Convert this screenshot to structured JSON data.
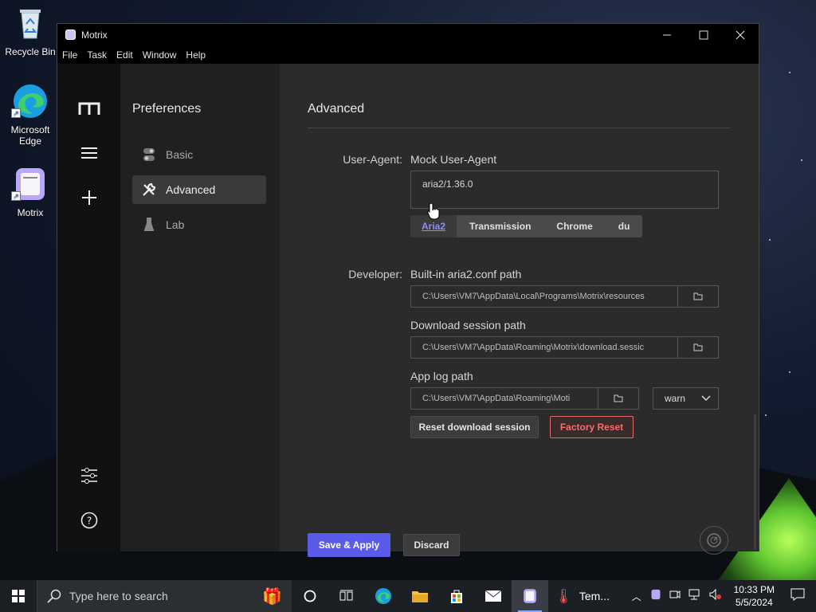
{
  "desktop": {
    "icons": [
      {
        "label": "Recycle Bin"
      },
      {
        "label": "Microsoft Edge"
      },
      {
        "label": "Motrix"
      }
    ]
  },
  "window": {
    "title": "Motrix",
    "menu": [
      "File",
      "Task",
      "Edit",
      "Window",
      "Help"
    ]
  },
  "sidebar": {
    "heading": "Preferences",
    "items": [
      {
        "label": "Basic",
        "icon": "toggle-icon"
      },
      {
        "label": "Advanced",
        "icon": "tools-icon",
        "active": true
      },
      {
        "label": "Lab",
        "icon": "flask-icon"
      }
    ]
  },
  "main": {
    "title": "Advanced",
    "user_agent": {
      "label": "User-Agent:",
      "sublabel": "Mock User-Agent",
      "value": "aria2/1.36.0",
      "presets": [
        "Aria2",
        "Transmission",
        "Chrome",
        "du"
      ]
    },
    "developer": {
      "label": "Developer:",
      "conf_label": "Built-in aria2.conf path",
      "conf_value": "C:\\Users\\VM7\\AppData\\Local\\Programs\\Motrix\\resources",
      "session_label": "Download session path",
      "session_value": "C:\\Users\\VM7\\AppData\\Roaming\\Motrix\\download.sessic",
      "log_label": "App log path",
      "log_value": "C:\\Users\\VM7\\AppData\\Roaming\\Moti",
      "log_level": "warn",
      "reset_session": "Reset download session",
      "factory_reset": "Factory Reset"
    },
    "save": "Save & Apply",
    "discard": "Discard"
  },
  "taskbar": {
    "search_placeholder": "Type here to search",
    "weather": "Tem...",
    "time": "10:33 PM",
    "date": "5/5/2024"
  },
  "colors": {
    "accent": "#5b5bea",
    "danger": "#f56c6c"
  }
}
